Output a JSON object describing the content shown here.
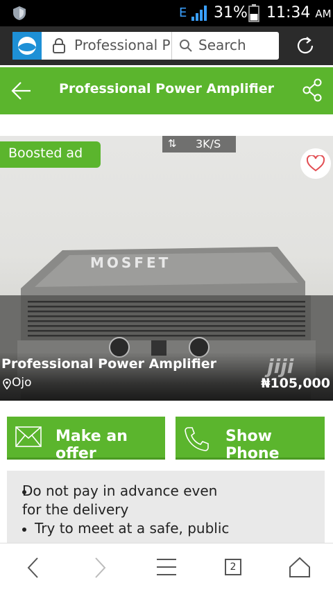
{
  "status_bar": {
    "network": "E",
    "battery_percent": "31%",
    "time": "11:34",
    "ampm": "AM"
  },
  "browser": {
    "url_text": "Professional P",
    "search_label": "Search"
  },
  "header": {
    "title": "Professional Power Amplifier"
  },
  "listing": {
    "badge": "Boosted ad",
    "speed": "3K/S",
    "photo_text": "MOSFET",
    "title": "Professional Power Amplifier",
    "location": "Ojo",
    "price": "₦105,000",
    "watermark": "jiji"
  },
  "actions": {
    "offer_label": "Make an offer",
    "phone_label": "Show Phone"
  },
  "safety": {
    "tip1": "Do not pay in advance even for the delivery",
    "tip2": "Try to meet at a safe, public"
  },
  "nav": {
    "tabs_count": "2"
  },
  "colors": {
    "brand_green": "#5bb52d",
    "browser_blue": "#1e90d6"
  }
}
